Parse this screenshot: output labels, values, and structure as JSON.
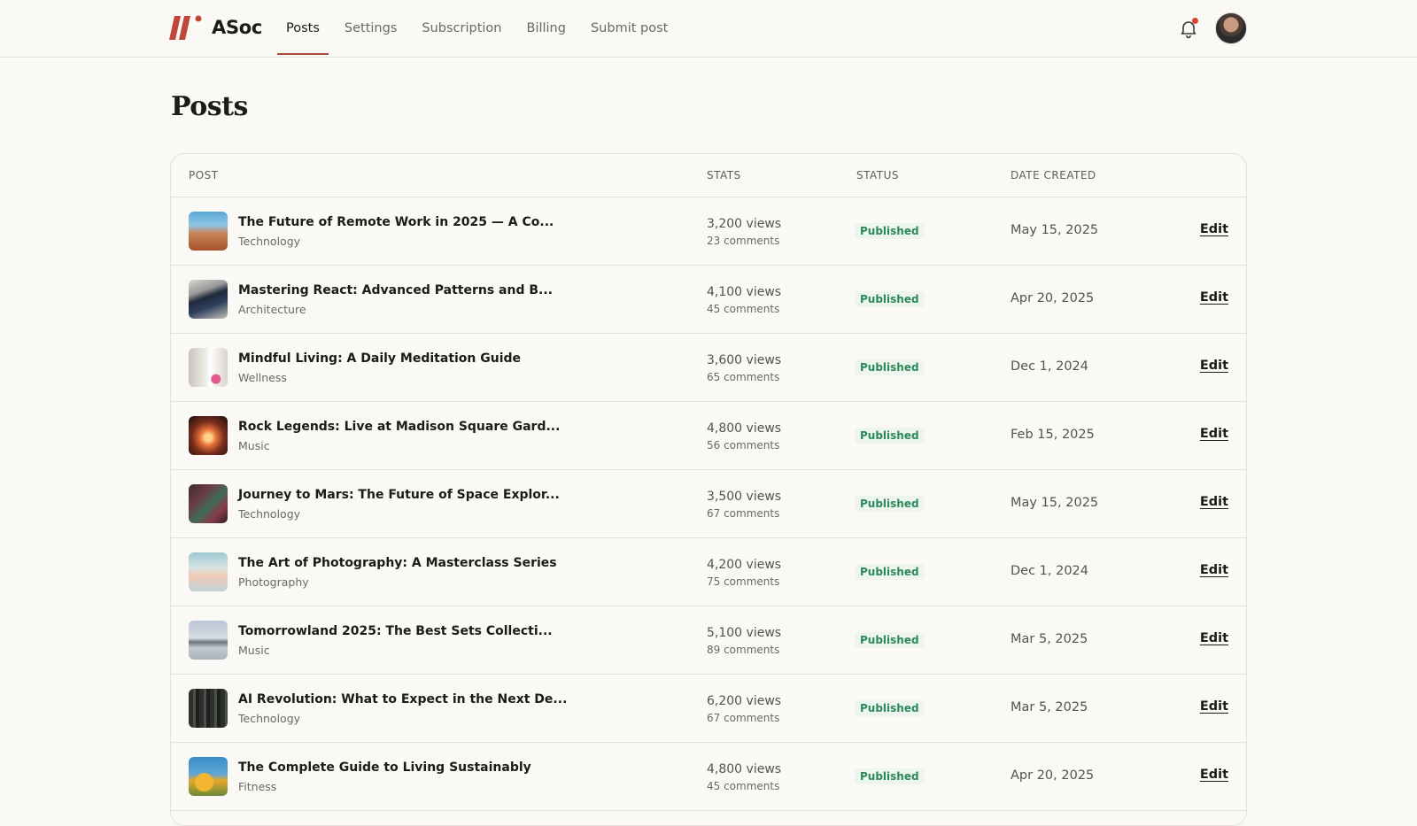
{
  "app": {
    "name": "ASoc"
  },
  "nav": {
    "items": [
      {
        "label": "Posts",
        "active": true
      },
      {
        "label": "Settings",
        "active": false
      },
      {
        "label": "Subscription",
        "active": false
      },
      {
        "label": "Billing",
        "active": false
      },
      {
        "label": "Submit post",
        "active": false
      }
    ]
  },
  "header": {
    "notification_icon": "bell-icon",
    "has_unread": true
  },
  "page": {
    "title": "Posts"
  },
  "table": {
    "columns": {
      "post": "POST",
      "stats": "STATS",
      "status": "STATUS",
      "date": "DATE CREATED"
    },
    "rows": [
      {
        "title": "The Future of Remote Work in 2025 — A Co...",
        "category": "Technology",
        "views": "3,200 views",
        "comments": "23 comments",
        "status": "Published",
        "date": "May 15, 2025",
        "action": "Edit"
      },
      {
        "title": "Mastering React: Advanced Patterns and B...",
        "category": "Architecture",
        "views": "4,100 views",
        "comments": "45 comments",
        "status": "Published",
        "date": "Apr 20, 2025",
        "action": "Edit"
      },
      {
        "title": "Mindful Living: A Daily Meditation Guide",
        "category": "Wellness",
        "views": "3,600 views",
        "comments": "65 comments",
        "status": "Published",
        "date": "Dec 1, 2024",
        "action": "Edit"
      },
      {
        "title": "Rock Legends: Live at Madison Square Gard...",
        "category": "Music",
        "views": "4,800 views",
        "comments": "56 comments",
        "status": "Published",
        "date": "Feb 15, 2025",
        "action": "Edit"
      },
      {
        "title": "Journey to Mars: The Future of Space Explor...",
        "category": "Technology",
        "views": "3,500 views",
        "comments": "67 comments",
        "status": "Published",
        "date": "May 15, 2025",
        "action": "Edit"
      },
      {
        "title": "The Art of Photography: A Masterclass Series",
        "category": "Photography",
        "views": "4,200 views",
        "comments": "75 comments",
        "status": "Published",
        "date": "Dec 1, 2024",
        "action": "Edit"
      },
      {
        "title": "Tomorrowland 2025: The Best Sets Collecti...",
        "category": "Music",
        "views": "5,100 views",
        "comments": "89 comments",
        "status": "Published",
        "date": "Mar 5, 2025",
        "action": "Edit"
      },
      {
        "title": "AI Revolution: What to Expect in the Next De...",
        "category": "Technology",
        "views": "6,200 views",
        "comments": "67 comments",
        "status": "Published",
        "date": "Mar 5, 2025",
        "action": "Edit"
      },
      {
        "title": "The Complete Guide to Living Sustainably",
        "category": "Fitness",
        "views": "4,800 views",
        "comments": "45 comments",
        "status": "Published",
        "date": "Apr 20, 2025",
        "action": "Edit"
      }
    ]
  },
  "colors": {
    "accent": "#a84a3c",
    "published": "#2c8a5a",
    "notification_dot": "#d9432f"
  }
}
